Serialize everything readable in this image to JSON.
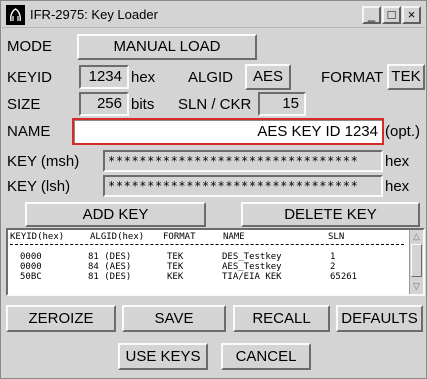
{
  "window": {
    "title": "IFR-2975: Key Loader",
    "minimize": "_",
    "maximize": "□",
    "close": "×"
  },
  "mode": {
    "label": "MODE",
    "value": "MANUAL LOAD"
  },
  "keyid": {
    "label": "KEYID",
    "value": "1234",
    "unit": "hex"
  },
  "algid": {
    "label": "ALGID",
    "value": "AES"
  },
  "format": {
    "label": "FORMAT",
    "value": "TEK"
  },
  "size": {
    "label": "SIZE",
    "value": "256",
    "unit": "bits"
  },
  "sln": {
    "label": "SLN / CKR",
    "value": "15"
  },
  "name": {
    "label": "NAME",
    "value": "AES KEY ID 1234",
    "suffix": "(opt.)"
  },
  "key_msh": {
    "label": "KEY (msh)",
    "value": "********************************",
    "unit": "hex"
  },
  "key_lsh": {
    "label": "KEY (lsh)",
    "value": "********************************",
    "unit": "hex"
  },
  "buttons": {
    "add_key": "ADD KEY",
    "delete_key": "DELETE KEY",
    "zeroize": "ZEROIZE",
    "save": "SAVE",
    "recall": "RECALL",
    "defaults": "DEFAULTS",
    "use_keys": "USE KEYS",
    "cancel": "CANCEL"
  },
  "key_list": {
    "headers": [
      "KEYID(hex)",
      "ALGID(hex)",
      "FORMAT",
      "NAME",
      "SLN"
    ],
    "rows": [
      [
        "0000",
        "81 (DES)",
        "TEK",
        "DES_Testkey",
        "1"
      ],
      [
        "0000",
        "84 (AES)",
        "TEK",
        "AES_Testkey",
        "2"
      ],
      [
        "50BC",
        "81 (DES)",
        "KEK",
        "TIA/EIA KEK",
        "65261"
      ]
    ]
  },
  "icons": {
    "app": "app-icon",
    "scroll_up": "scroll-up-arrow-icon",
    "scroll_down": "scroll-down-arrow-icon"
  }
}
